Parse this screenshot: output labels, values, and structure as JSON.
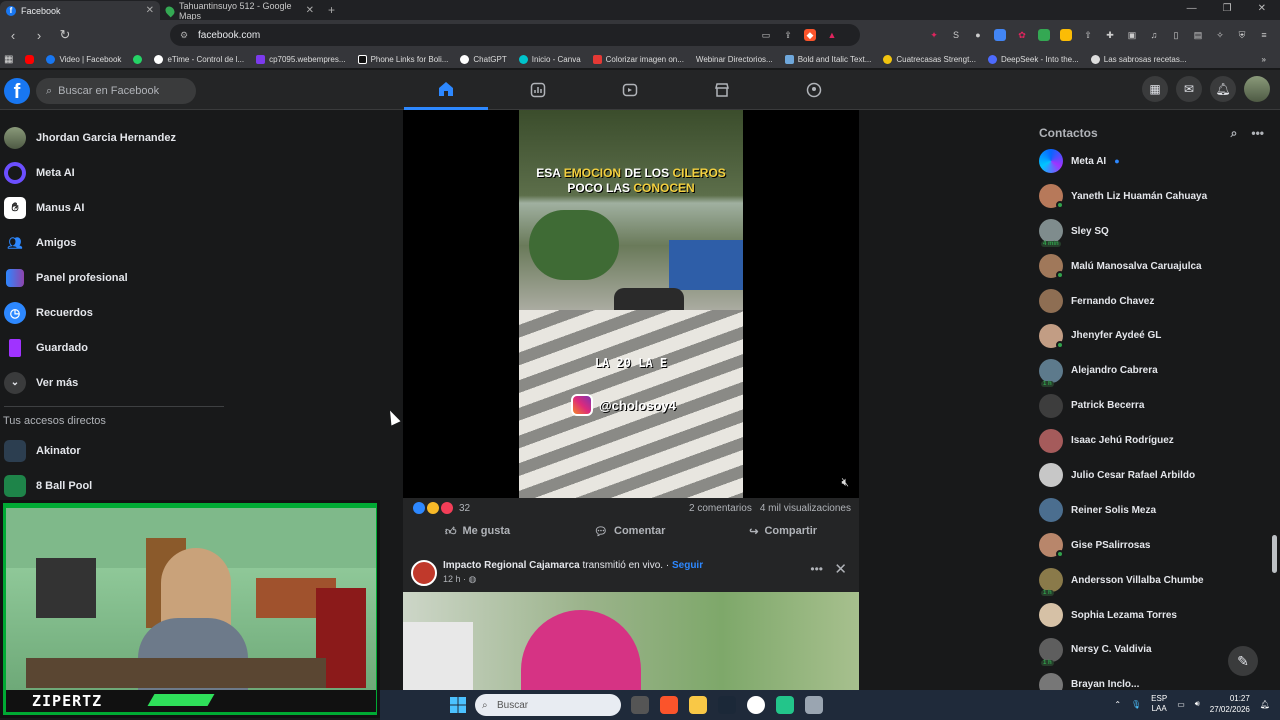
{
  "browser": {
    "tabs": [
      {
        "title": "Facebook",
        "icon": "facebook-favicon"
      },
      {
        "title": "Tahuantinsuyo 512 - Google Maps",
        "icon": "google-maps-favicon"
      }
    ],
    "url": "facebook.com",
    "bookmarks": [
      "Video | Facebook",
      "eTime - Control de l...",
      "cp7095.webempres...",
      "Phone Links for Boli...",
      "ChatGPT",
      "Inicio - Canva",
      "Colorizar imagen on...",
      "Webinar Directorios...",
      "Bold and Italic Text...",
      "Cuatrecasas Strengt...",
      "DeepSeek - Into the...",
      "Las sabrosas recetas..."
    ]
  },
  "header": {
    "search_placeholder": "Buscar en Facebook"
  },
  "sidebar": {
    "items": [
      {
        "label": "Jhordan Garcia Hernandez",
        "icon": "user-avatar"
      },
      {
        "label": "Meta AI",
        "icon": "meta-ai-icon"
      },
      {
        "label": "Manus AI",
        "icon": "manus-ai-icon"
      },
      {
        "label": "Amigos",
        "icon": "friends-icon"
      },
      {
        "label": "Panel profesional",
        "icon": "dashboard-icon"
      },
      {
        "label": "Recuerdos",
        "icon": "clock-icon"
      },
      {
        "label": "Guardado",
        "icon": "bookmark-icon"
      },
      {
        "label": "Ver más",
        "icon": "chevron-down-icon"
      }
    ],
    "shortcuts_title": "Tus accesos directos",
    "shortcuts": [
      {
        "label": "Akinator"
      },
      {
        "label": "8 Ball Pool"
      }
    ]
  },
  "webcam": {
    "name": "ZIPERTZ"
  },
  "post1": {
    "caption_parts": [
      "ESA ",
      "EMOCION",
      " DE LOS ",
      "CILEROS",
      "POCO LAS ",
      "CONOCEN"
    ],
    "mid_text": "LA 20 LA E",
    "instagram_handle": "@cholosoy4",
    "reaction_count": "32",
    "comments": "2 comentarios",
    "views": "4 mil visualizaciones",
    "like_label": "Me gusta",
    "comment_label": "Comentar",
    "share_label": "Compartir"
  },
  "post2": {
    "page_name": "Impacto Regional Cajamarca",
    "action": " transmitió en vivo. · ",
    "follow": "Seguir",
    "time": "12 h · "
  },
  "contacts": {
    "title": "Contactos",
    "items": [
      {
        "name": "Meta AI",
        "verified": true
      },
      {
        "name": "Yaneth Liz Huamán Cahuaya",
        "online": true
      },
      {
        "name": "Sley SQ",
        "badge": "4 min"
      },
      {
        "name": "Malú Manosalva Caruajulca",
        "online": true
      },
      {
        "name": "Fernando Chavez"
      },
      {
        "name": "Jhenyfer Aydeé GL",
        "online": true
      },
      {
        "name": "Alejandro Cabrera",
        "badge": "1 h"
      },
      {
        "name": "Patrick Becerra"
      },
      {
        "name": "Isaac Jehú Rodríguez"
      },
      {
        "name": "Julio Cesar Rafael Arbildo"
      },
      {
        "name": "Reiner Solis Meza"
      },
      {
        "name": "Gise PSalirrosas",
        "online": true
      },
      {
        "name": "Andersson Villalba Chumbe",
        "badge": "1 h"
      },
      {
        "name": "Sophia Lezama Torres"
      },
      {
        "name": "Nersy C. Valdivia",
        "badge": "1 h"
      },
      {
        "name": "Brayan Inclo..."
      }
    ]
  },
  "taskbar": {
    "search_placeholder": "Buscar",
    "lang_top": "ESP",
    "lang_bottom": "LAA",
    "time": "01:27",
    "date": "27/02/2026"
  },
  "colors": {
    "fb_blue": "#1877f2",
    "link_blue": "#2d88ff",
    "online_green": "#31a24c",
    "bg": "#18191a",
    "card": "#242526"
  }
}
